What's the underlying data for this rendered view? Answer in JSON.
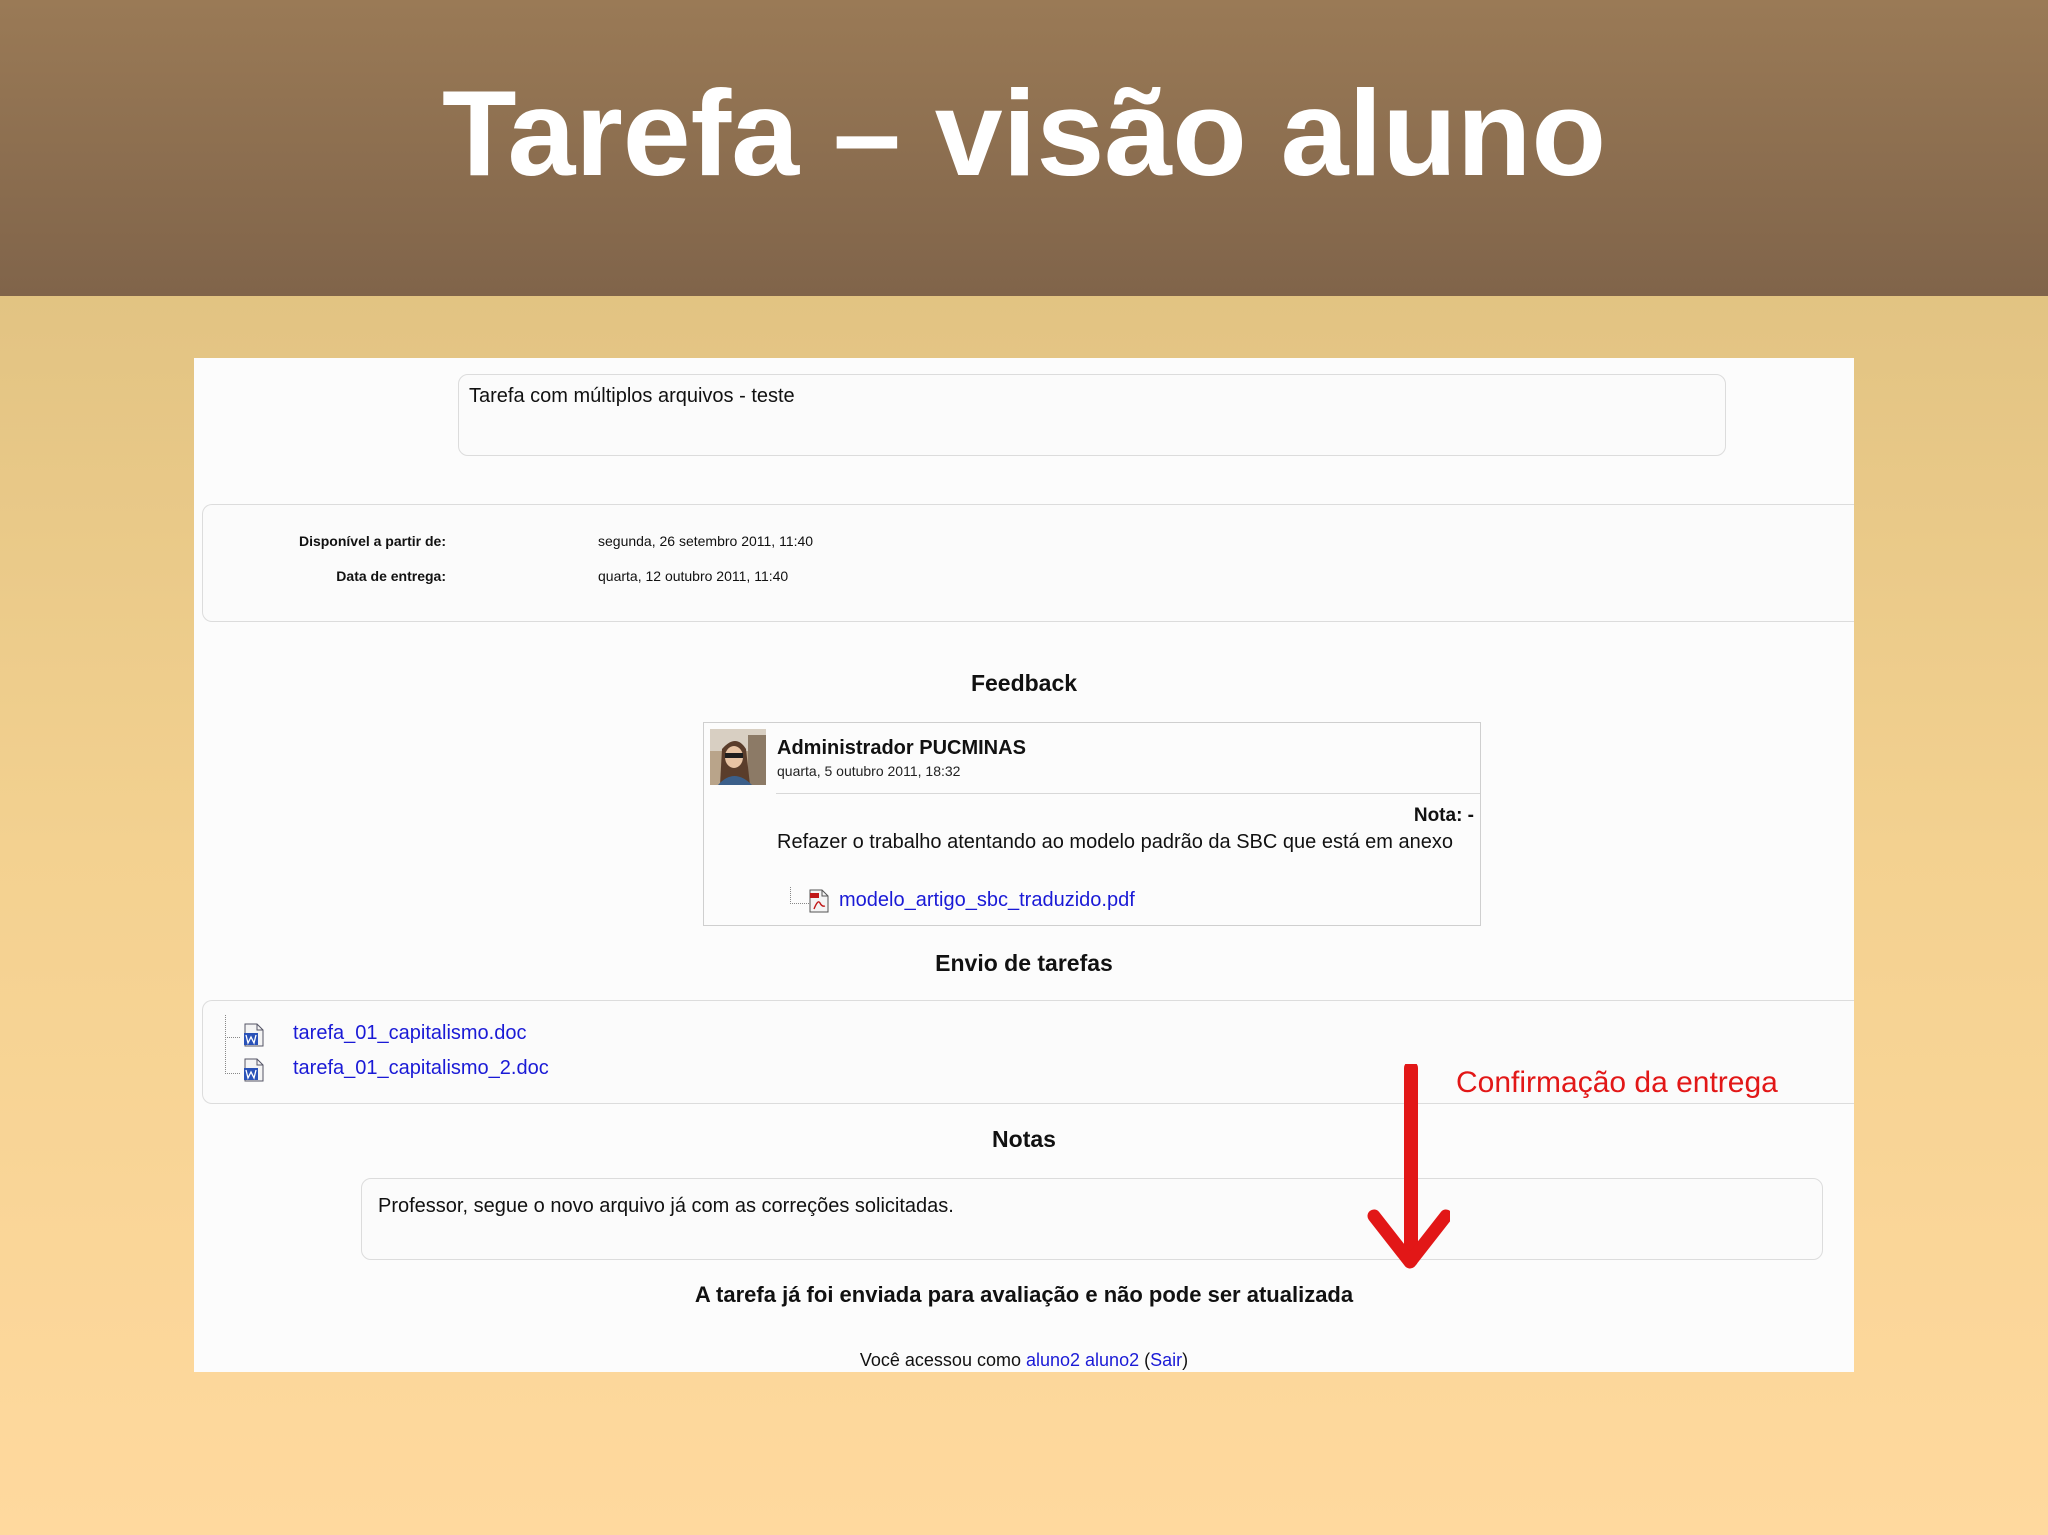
{
  "slide": {
    "title": "Tarefa – visão aluno"
  },
  "assignment": {
    "description": "Tarefa com múltiplos arquivos - teste",
    "available_label": "Disponível a partir de:",
    "available_value": "segunda, 26 setembro 2011, 11:40",
    "due_label": "Data de entrega:",
    "due_value": "quarta, 12 outubro 2011, 11:40"
  },
  "feedback": {
    "heading": "Feedback",
    "author": "Administrador PUCMINAS",
    "date": "quarta, 5 outubro 2011, 18:32",
    "grade": "Nota: -",
    "text": "Refazer o trabalho atentando ao modelo padrão da SBC que está em anexo",
    "file": "modelo_artigo_sbc_traduzido.pdf",
    "file_icon": "pdf-file-icon"
  },
  "submission": {
    "heading": "Envio de tarefas",
    "files": [
      "tarefa_01_capitalismo.doc",
      "tarefa_01_capitalismo_2.doc"
    ],
    "file_icon": "word-doc-icon"
  },
  "notes": {
    "heading": "Notas",
    "text": "Professor, segue o novo arquivo já com as correções solicitadas."
  },
  "status": {
    "text": "A tarefa já foi enviada para avaliação e não pode ser atualizada"
  },
  "login": {
    "prefix": "Você acessou como ",
    "user": "aluno2 aluno2",
    "open": " (",
    "logout": "Sair",
    "close": ")"
  },
  "annotation": {
    "text": "Confirmação da entrega",
    "color": "#e21717"
  }
}
